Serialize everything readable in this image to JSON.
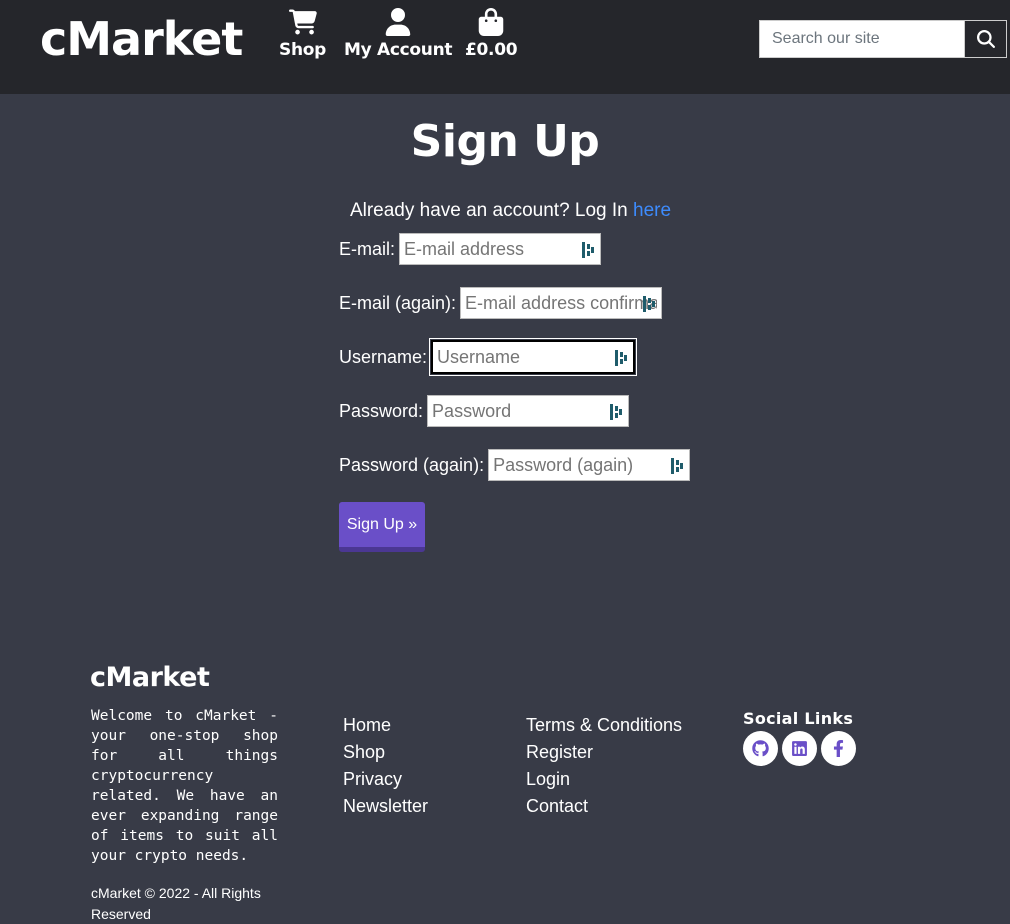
{
  "header": {
    "logo": "cMarket",
    "nav": [
      {
        "label": "Shop",
        "icon": "shopping-cart-icon"
      },
      {
        "label": "My Account",
        "icon": "user-icon"
      },
      {
        "label": "£0.00",
        "icon": "shopping-bag-icon"
      }
    ],
    "search": {
      "placeholder": "Search our site",
      "icon": "search-icon"
    }
  },
  "main": {
    "title": "Sign Up",
    "already_text": "Already have an account? Log In ",
    "login_link": "here",
    "fields": [
      {
        "label": "E-mail:",
        "placeholder": "E-mail address"
      },
      {
        "label": "E-mail (again):",
        "placeholder": "E-mail address confirmation"
      },
      {
        "label": "Username:",
        "placeholder": "Username"
      },
      {
        "label": "Password:",
        "placeholder": "Password"
      },
      {
        "label": "Password (again):",
        "placeholder": "Password (again)"
      }
    ],
    "submit_label": "Sign Up »"
  },
  "footer": {
    "logo": "cMarket",
    "description": "Welcome to cMarket - your one-stop shop for all things cryptocurrency related. We have an ever expanding range of items to suit all your crypto needs.",
    "copyright": "cMarket © 2022 - All Rights Reserved",
    "links_col1": [
      "Home",
      "Shop",
      "Privacy",
      "Newsletter"
    ],
    "links_col2": [
      "Terms & Conditions",
      "Register",
      "Login",
      "Contact"
    ],
    "social_title": "Social Links",
    "social": [
      {
        "name": "GitHub",
        "icon": "github-icon"
      },
      {
        "name": "LinkedIn",
        "icon": "linkedin-icon"
      },
      {
        "name": "Facebook",
        "icon": "facebook-icon"
      }
    ]
  },
  "colors": {
    "background": "#383b47",
    "header_bg": "#25262b",
    "accent": "#6a4fc8",
    "link": "#3d8bfd"
  }
}
